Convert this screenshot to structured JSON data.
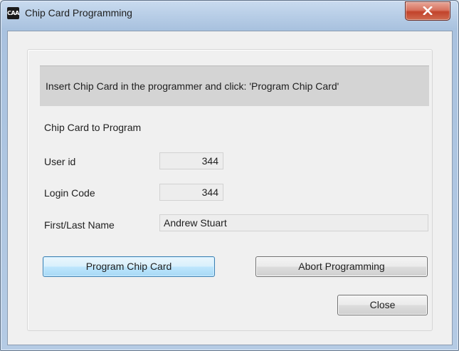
{
  "window": {
    "title": "Chip Card Programming",
    "app_icon_text": "CAA"
  },
  "banner": {
    "message": "Insert Chip Card in the programmer and click: 'Program Chip Card'"
  },
  "section": {
    "heading": "Chip Card to Program"
  },
  "fields": {
    "user_id": {
      "label": "User id",
      "value": "344"
    },
    "login_code": {
      "label": "Login Code",
      "value": "344"
    },
    "name": {
      "label": "First/Last Name",
      "value": "Andrew Stuart"
    }
  },
  "buttons": {
    "program": "Program Chip Card",
    "abort": "Abort Programming",
    "close": "Close"
  },
  "colors": {
    "close_button": "#c2432b",
    "focus_button": "#bee6fd",
    "banner_bg": "#d4d4d4"
  }
}
